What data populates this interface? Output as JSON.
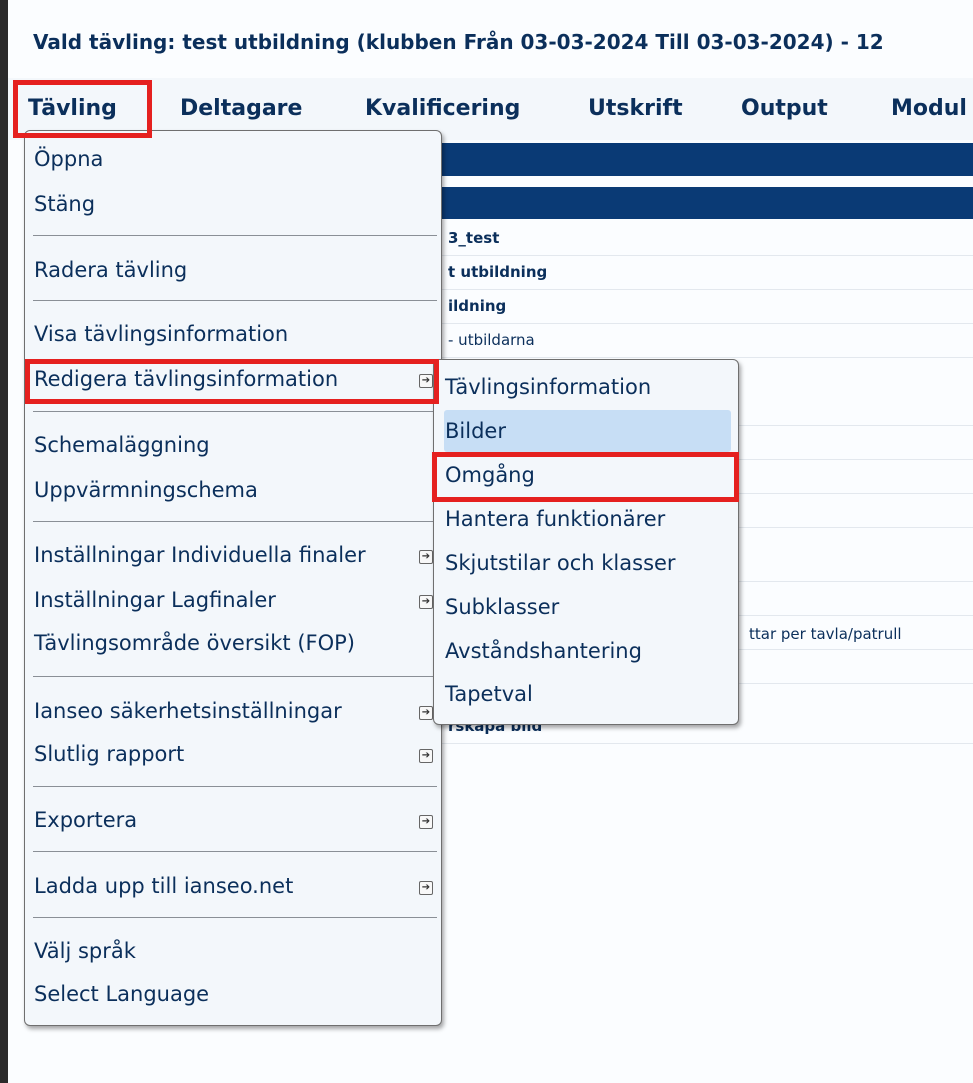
{
  "page": {
    "title": "Vald tävling: test utbildning (klubben Från 03-03-2024 Till 03-03-2024) - 12"
  },
  "menubar": {
    "items": [
      "Tävling",
      "Deltagare",
      "Kvalificering",
      "Utskrift",
      "Output",
      "Modul"
    ]
  },
  "background_rows": [
    "3_test",
    "t utbildning",
    "ildning",
    "- utbildarna",
    "ttar per tavla/patrull",
    "rskapa bild"
  ],
  "dropdown": {
    "items": [
      "Öppna",
      "Stäng",
      "Radera tävling",
      "Visa tävlingsinformation",
      "Redigera tävlingsinformation",
      "Schemaläggning",
      "Uppvärmningschema",
      "Inställningar Individuella finaler",
      "Inställningar Lagfinaler",
      "Tävlingsområde översikt (FOP)",
      "Ianseo säkerhetsinställningar",
      "Slutlig rapport",
      "Exportera",
      "Ladda upp till ianseo.net",
      "Välj språk",
      "Select Language"
    ]
  },
  "submenu": {
    "items": [
      "Tävlingsinformation",
      "Bilder",
      "Omgång",
      "Hantera funktionärer",
      "Skjutstilar och klasser",
      "Subklasser",
      "Avståndshantering",
      "Tapetval"
    ],
    "hover_item": "Bilder"
  },
  "highlights": {
    "color": "#e5201f",
    "boxed_items": [
      "Tävling",
      "Redigera tävlingsinformation",
      "Omgång"
    ]
  },
  "icons": {
    "submenu_arrow": "submenu-arrow-icon"
  }
}
